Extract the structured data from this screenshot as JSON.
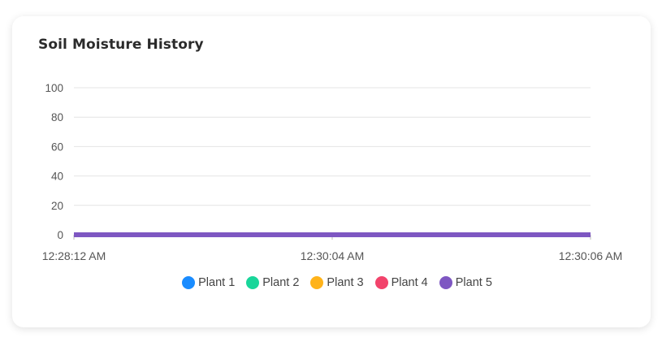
{
  "card": {
    "title": "Soil Moisture History"
  },
  "colors": {
    "grid": "#e4e4e4",
    "axis": "#bdbdbd",
    "tick_text": "#555555"
  },
  "chart_data": {
    "type": "line",
    "title": "Soil Moisture History",
    "xlabel": "",
    "ylabel": "",
    "categories": [
      "12:28:12 AM",
      "12:30:04 AM",
      "12:30:06 AM"
    ],
    "ylim": [
      0,
      100
    ],
    "yticks": [
      0,
      20,
      40,
      60,
      80,
      100
    ],
    "grid": true,
    "legend_position": "bottom",
    "series": [
      {
        "name": "Plant 1",
        "color": "#1a8cff",
        "values": [
          0,
          0,
          0
        ]
      },
      {
        "name": "Plant 2",
        "color": "#19d69a",
        "values": [
          0,
          0,
          0
        ]
      },
      {
        "name": "Plant 3",
        "color": "#ffb31a",
        "values": [
          0,
          0,
          0
        ]
      },
      {
        "name": "Plant 4",
        "color": "#f2436b",
        "values": [
          0,
          0,
          0
        ]
      },
      {
        "name": "Plant 5",
        "color": "#7e57c2",
        "values": [
          0,
          0,
          0
        ]
      }
    ]
  }
}
